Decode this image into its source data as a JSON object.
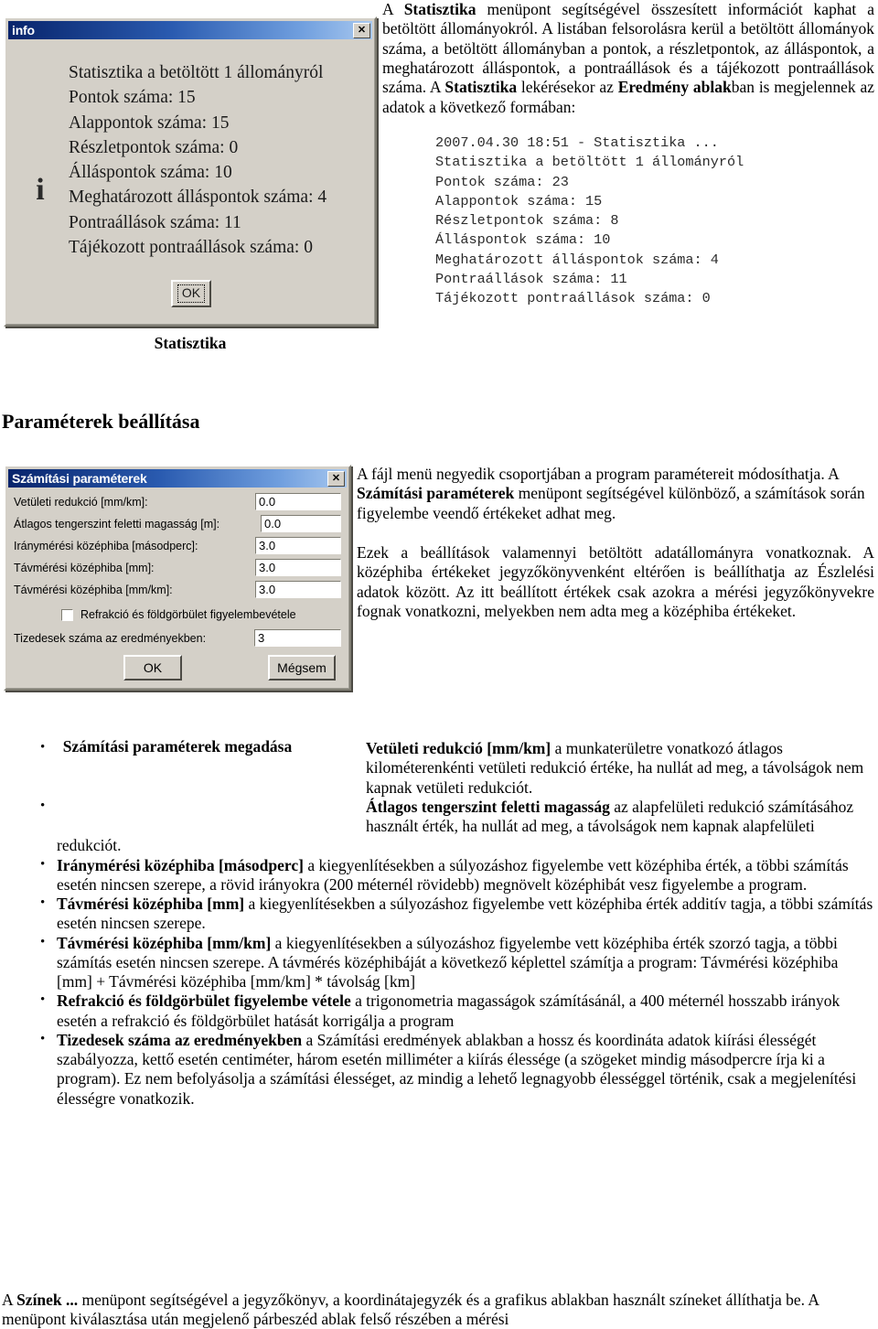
{
  "section1": {
    "dialog": {
      "title": "info",
      "close_label": "✕",
      "icon": "info-icon",
      "lines": [
        "Statisztika a betöltött 1 állományról",
        "Pontok száma: 15",
        "Alappontok száma: 15",
        "Részletpontok száma: 0",
        "Álláspontok száma: 10",
        "Meghatározott álláspontok száma: 4",
        "Pontraállások száma: 11",
        "Tájékozott pontraállások száma: 0"
      ],
      "ok_label": "OK"
    },
    "caption": "Statisztika",
    "paragraph": {
      "t1": "A ",
      "b1": "Statisztika",
      "t2": " menüpont segítségével összesített információt kaphat a betöltött állományokról. A listában felsorolásra kerül a betöltött állományok száma, a betöltött állományban a pontok, a részletpontok, az álláspontok, a meghatározott álláspontok, a pontraállások és a tájékozott pontraállások száma. A ",
      "b2": "Statisztika",
      "t3": " lekérésekor az ",
      "b3": "Eredmény ablak",
      "t4": "ban is megjelennek az adatok a következő formában:"
    },
    "mono_block": "2007.04.30 18:51 - Statisztika ...\nStatisztika a betöltött 1 állományról\nPontok száma: 23\nAlappontok száma: 15\nRészletpontok száma: 8\nÁlláspontok száma: 10\nMeghatározott álláspontok száma: 4\nPontraállások száma: 11\nTájékozott pontraállások száma: 0"
  },
  "heading": "Paraméterek beállítása",
  "section2": {
    "dialog": {
      "title": "Számítási paraméterek",
      "close_label": "✕",
      "fields": [
        {
          "label": "Vetületi redukció [mm/km]:",
          "value": "0.0"
        },
        {
          "label": "Átlagos tengerszint feletti magasság [m]:",
          "value": "0.0"
        },
        {
          "label": "Iránymérési középhiba [másodperc]:",
          "value": "3.0"
        },
        {
          "label": "Távmérési középhiba [mm]:",
          "value": "3.0"
        },
        {
          "label": "Távmérési középhiba [mm/km]:",
          "value": "3.0"
        }
      ],
      "checkbox": {
        "label": "Refrakció és földgörbület figyelembevétele",
        "checked": false
      },
      "decimals": {
        "label": "Tizedesek száma az eredményekben:",
        "value": "3"
      },
      "ok_label": "OK",
      "cancel_label": "Mégsem"
    },
    "caption": "Számítási paraméterek megadása",
    "paragraph1": {
      "t1": "A fájl menü negyedik csoportjában a program paramétereit módosíthatja. A ",
      "b1": "Számítási paraméterek",
      "t2": " menüpont segítségével különböző, a számítások során figyelembe veendő értékeket adhat meg."
    },
    "paragraph2": "Ezek a beállítások valamennyi betöltött adatállományra vonatkoznak. A középhiba értékeket jegyzőkönyvenként eltérően is beállíthatja az Észlelési adatok között. Az itt beállított értékek csak azokra a mérési jegyzőkönyvekre fognak vonatkozni, melyekben nem adta meg a középhiba értékeket."
  },
  "bullets": {
    "marker": "•",
    "items": [
      {
        "term": "Vetületi redukció [mm/km]",
        "text": " a munkaterületre vonatkozó átlagos kilométerenkénti vetületi redukció értéke, ha nullát ad meg, a távolságok nem kapnak vetületi redukciót."
      },
      {
        "term": "Átlagos tengerszint feletti magasság",
        "text": " az alapfelületi redukció számításához használt érték, ha nullát ad meg, a távolságok nem kapnak alapfelületi redukciót."
      },
      {
        "term": "Iránymérési középhiba [másodperc]",
        "text": " a kiegyenlítésekben a súlyozáshoz figyelembe vett középhiba érték, a többi számítás esetén nincsen szerepe, a rövid irányokra (200 méternél rövidebb) megnövelt középhibát vesz figyelembe a program."
      },
      {
        "term": "Távmérési középhiba [mm]",
        "text": " a kiegyenlítésekben a súlyozáshoz figyelembe vett középhiba érték additív tagja, a többi számítás esetén nincsen szerepe."
      },
      {
        "term": "Távmérési középhiba [mm/km]",
        "text": " a kiegyenlítésekben a súlyozáshoz figyelembe vett középhiba érték szorzó tagja, a többi számítás esetén nincsen szerepe. A távmérés középhibáját a következő képlettel számítja a program: Távmérési középhiba [mm] + Távmérési középhiba [mm/km] * távolság [km]"
      },
      {
        "term": "Refrakció és földgörbület figyelembe vétele",
        "text": " a trigonometria magasságok számításánál, a 400 méternél hosszabb irányok esetén a refrakció és földgörbület hatását korrigálja a program"
      },
      {
        "term": "Tizedesek száma az eredményekben",
        "text": " a Számítási eredmények ablakban a hossz és koordináta adatok kiírási élességét szabályozza, kettő esetén centiméter, három esetén milliméter a kiírás élessége (a szögeket mindig másodpercre írja ki a program). Ez nem befolyásolja a számítási élességet, az mindig a lehető legnagyobb élességgel történik, csak a megjelenítési élességre vonatkozik."
      }
    ]
  },
  "tail": {
    "t1": "A ",
    "b1": "Színek ...",
    "t2": " menüpont segítségével a jegyzőkönyv, a koordinátajegyzék és a grafikus ablakban használt színeket állíthatja be. A menüpont kiválasztása után megjelenő párbeszéd ablak felső részében a mérési"
  }
}
